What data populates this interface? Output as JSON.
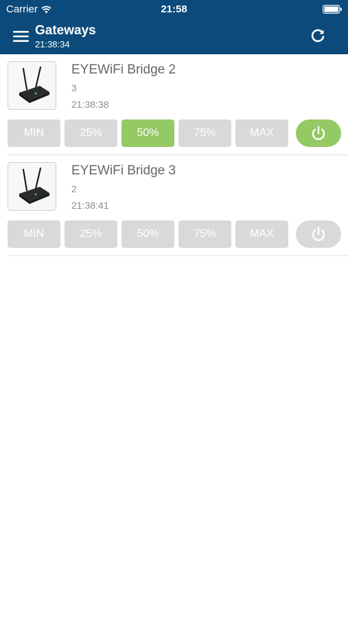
{
  "status_bar": {
    "carrier": "Carrier",
    "time": "21:58"
  },
  "header": {
    "title": "Gateways",
    "subtitle": "21:38:34",
    "bg_color": "#0b4a7a"
  },
  "level_labels": [
    "MIN",
    "25%",
    "50%",
    "75%",
    "MAX"
  ],
  "gateways": [
    {
      "name": "EYEWiFi Bridge 2",
      "count": "3",
      "time": "21:38:38",
      "active_level": "50%",
      "power_on": true
    },
    {
      "name": "EYEWiFi Bridge 3",
      "count": "2",
      "time": "21:38:41",
      "active_level": null,
      "power_on": false
    }
  ],
  "colors": {
    "active_green": "#95c964",
    "inactive_gray": "#d9d9d9"
  },
  "icons": {
    "menu": "hamburger-menu-icon",
    "refresh": "refresh-icon",
    "power": "power-icon",
    "wifi": "wifi-icon",
    "battery": "battery-icon"
  }
}
